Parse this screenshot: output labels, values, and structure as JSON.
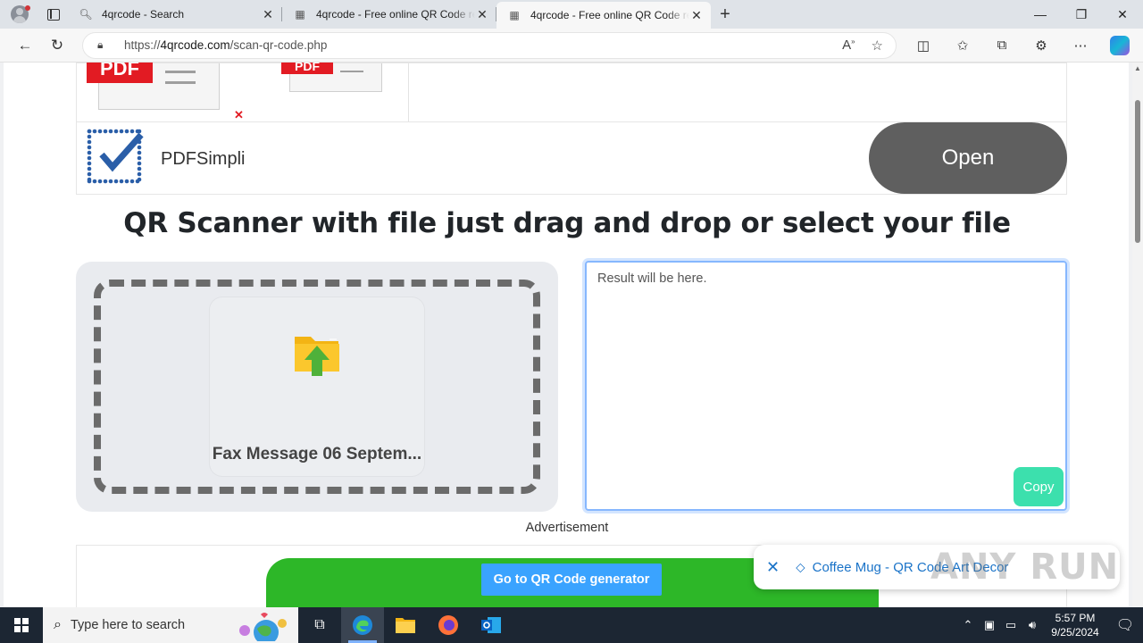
{
  "browser": {
    "tabs": [
      {
        "title": "4qrcode - Search",
        "active": false,
        "icon": "search-icon"
      },
      {
        "title": "4qrcode - Free online QR Code re",
        "active": false,
        "icon": "qr-icon"
      },
      {
        "title": "4qrcode - Free online QR Code re",
        "active": true,
        "icon": "qr-icon"
      }
    ],
    "url_prefix": "https://",
    "url_domain": "4qrcode.com",
    "url_path": "/scan-qr-code.php"
  },
  "ad_top": {
    "pdf_label": "PDF",
    "brand": "PDFSimpli",
    "open_label": "Open"
  },
  "main": {
    "heading": "QR Scanner with file just drag and drop or select your file",
    "file_name": "Fax Message 06 Septem...",
    "result_placeholder": "Result will be here.",
    "copy_label": "Copy",
    "advertisement_label": "Advertisement",
    "go_generator_label": "Go to QR Code generator"
  },
  "toast": {
    "label": "Coffee Mug - QR Code Art Decor"
  },
  "watermark": "ANY RUN",
  "taskbar": {
    "search_placeholder": "Type here to search",
    "time": "5:57 PM",
    "date": "9/25/2024"
  },
  "colors": {
    "accent_green": "#3ce0ad",
    "ad_green": "#2db728",
    "button_blue": "#3aa3ff",
    "pdf_red": "#e21b23"
  }
}
